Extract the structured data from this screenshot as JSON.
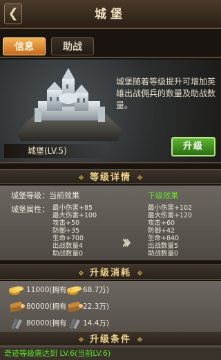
{
  "header": {
    "title": "城堡",
    "back_icon": "back-arrow-icon"
  },
  "tabs": [
    {
      "label": "信息",
      "active": true
    },
    {
      "label": "助战",
      "active": false
    }
  ],
  "hero": {
    "castle_name": "城堡(LV.5)",
    "description": "城堡随着等级提升可增加英雄出战佣兵的数量及助战数量。",
    "upgrade_label": "升级"
  },
  "level_details": {
    "title": "等级详情",
    "current_label": "城堡等级：当前效果",
    "next_label": "下级效果",
    "attr_label": "城堡属性：",
    "current": [
      "最小伤害+85",
      "最大伤害+100",
      "攻击+50",
      "防御+35",
      "生命+700",
      "出战数量4",
      "助战数量0"
    ],
    "next": [
      "最小伤害+102",
      "最大伤害+120",
      "攻击+60",
      "防御+42",
      "生命+840",
      "出战数量5",
      "助战数量0"
    ]
  },
  "upgrade_cost": {
    "title": "升级消耗",
    "rows": [
      {
        "icon": "gold-coins-icon",
        "amount": "11000(拥有",
        "owned": "68.7万)"
      },
      {
        "icon": "wood-logs-icon",
        "amount": "80000(拥有",
        "owned": "22.3万)"
      },
      {
        "icon": "iron-ore-icon",
        "amount": "80000(拥有",
        "owned": "14.4万)"
      }
    ]
  },
  "upgrade_condition": {
    "title": "升级条件",
    "text": "奇迹等级需达到 LV.6(当前LV.6)"
  },
  "colors": {
    "accent_green": "#6be22e",
    "tab_active": "#e08a30",
    "gold_title": "#f2d48a"
  }
}
